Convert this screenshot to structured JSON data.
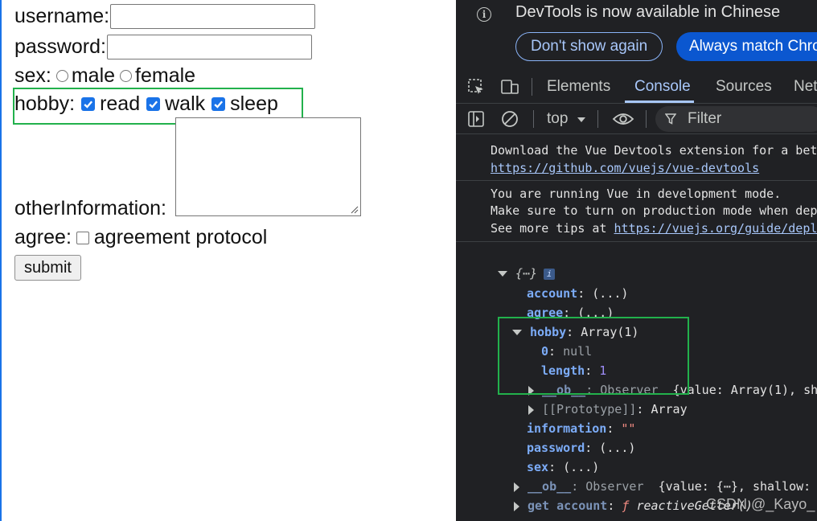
{
  "form": {
    "username_label": "username:",
    "password_label": "password:",
    "sex_label": "sex:",
    "sex_options": [
      "male",
      "female"
    ],
    "hobby_label": "hobby:",
    "hobby_options": [
      "read",
      "walk",
      "sleep"
    ],
    "other_label": "otherInformation:",
    "agree_label": "agree:",
    "agree_text": "agreement protocol",
    "submit_label": "submit"
  },
  "devtools": {
    "banner_text": "DevTools is now available in Chinese",
    "dont_show_label": "Don't show again",
    "always_match_label": "Always match Chro",
    "tabs": [
      "Elements",
      "Console",
      "Sources",
      "Net"
    ],
    "active_tab": "Console",
    "context": "top",
    "filter_placeholder": "Filter",
    "console": {
      "vue_devtools_line": "Download the Vue Devtools extension for a bet",
      "vue_devtools_link": "https://github.com/vuejs/vue-devtools",
      "dev_mode_line1": "You are running Vue in development mode.",
      "dev_mode_line2": "Make sure to turn on production mode when dep",
      "dev_mode_line3_prefix": "See more tips at ",
      "dev_mode_link": "https://vuejs.org/guide/depl",
      "object_label": "{⋯}",
      "info_badge": "i",
      "rows": {
        "account_key": "account",
        "account_val": ": (...)",
        "agree_key": "agree",
        "agree_val": ": (...)",
        "hobby_key": "hobby",
        "hobby_val": ": Array(1)",
        "item0_key": "0",
        "item0_val": "null",
        "length_key": "length",
        "length_val": "1",
        "ob_key": "__ob__",
        "ob_val_dim": ": Observer",
        "ob_val_rest": "{value: Array(1), sh",
        "proto_key": "[[Prototype]]",
        "proto_val": ": Array",
        "information_key": "information",
        "information_val": "\"\"",
        "password_key": "password",
        "password_val": ": (...)",
        "sex_key": "sex",
        "sex_val": ": (...)",
        "ob2_key": "__ob__",
        "ob2_val_dim": ": Observer",
        "ob2_val_rest": "{value: {⋯}, shallow:",
        "getter_key": "get account",
        "getter_val": "reactiveGetter()"
      }
    }
  },
  "watermark": "CSDN @_Kayo_",
  "colors": {
    "highlight_box": "#22b14c",
    "checkbox_accent": "#1a73e8",
    "devtools_bg": "#202124",
    "devtools_accent": "#a8c7fa"
  }
}
